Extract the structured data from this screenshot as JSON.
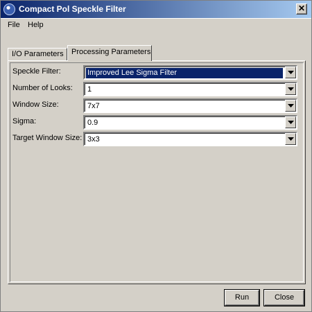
{
  "window": {
    "title": "Compact Pol Speckle Filter"
  },
  "menu": {
    "file": "File",
    "help": "Help"
  },
  "tabs": [
    {
      "label": "I/O Parameters",
      "active": false
    },
    {
      "label": "Processing Parameters",
      "active": true
    }
  ],
  "params": {
    "speckle_filter": {
      "label": "Speckle Filter:",
      "value": "Improved Lee Sigma Filter"
    },
    "number_of_looks": {
      "label": "Number of Looks:",
      "value": "1"
    },
    "window_size": {
      "label": "Window Size:",
      "value": "7x7"
    },
    "sigma": {
      "label": "Sigma:",
      "value": "0.9"
    },
    "target_window_size": {
      "label": "Target Window Size:",
      "value": "3x3"
    }
  },
  "buttons": {
    "run": "Run",
    "close": "Close"
  },
  "icons": {
    "app": "globe-logo-icon",
    "close": "close-icon",
    "dropdown": "chevron-down-icon"
  },
  "colors": {
    "title_gradient_start": "#0a246a",
    "title_gradient_end": "#a6caf0",
    "selection": "#0a246a",
    "face": "#d4d0c8"
  }
}
